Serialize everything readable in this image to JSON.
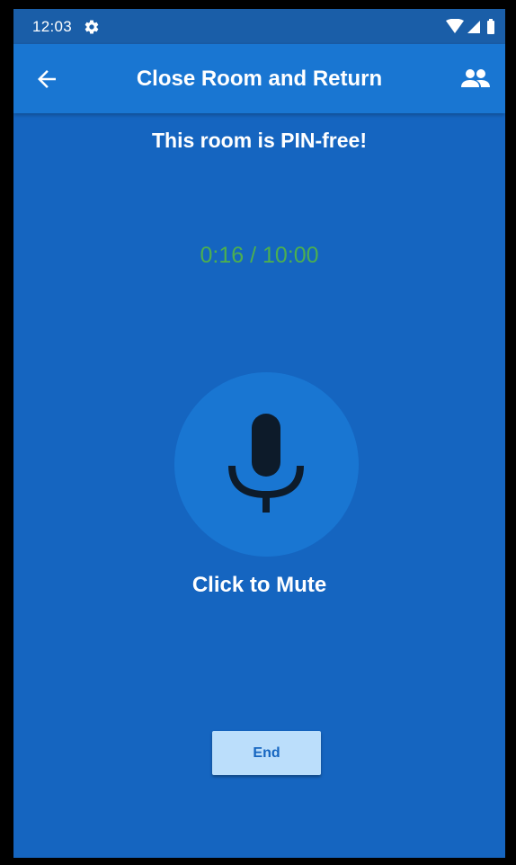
{
  "status_bar": {
    "time": "12:03",
    "icons": [
      "gear-icon",
      "wifi-icon",
      "signal-icon",
      "battery-icon"
    ]
  },
  "app_bar": {
    "back_icon": "arrow-left-icon",
    "title": "Close Room and Return",
    "participants_icon": "people-icon"
  },
  "room": {
    "pin_message": "This room is PIN-free!",
    "timer": "0:16 / 10:00",
    "mic_icon": "microphone-icon",
    "mute_label": "Click to Mute",
    "end_label": "End"
  },
  "colors": {
    "background": "#1565c0",
    "app_bar": "#1976d2",
    "status_bar": "#1a5ea8",
    "timer": "#4caf50",
    "mic_circle": "#1976d2",
    "end_button": "#bbdefb",
    "mic_icon": "#0d1b2a"
  }
}
